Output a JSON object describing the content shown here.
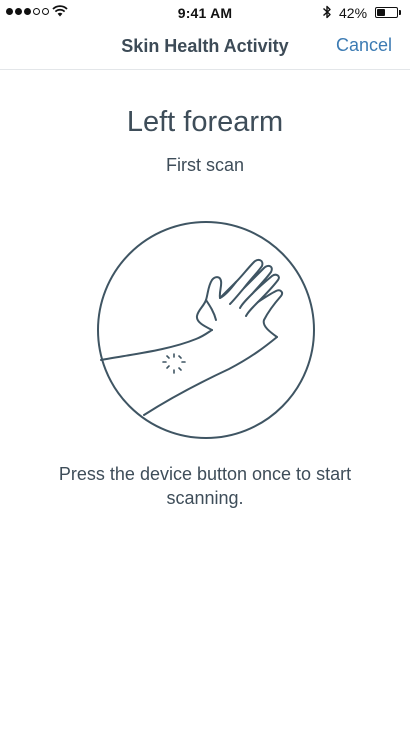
{
  "status_bar": {
    "signal_strength": 3,
    "signal_total": 5,
    "time": "9:41 AM",
    "battery_percent_text": "42%",
    "battery_level": 0.42,
    "icons": [
      "signal-dots-icon",
      "wifi-icon",
      "bluetooth-icon",
      "battery-icon"
    ]
  },
  "nav": {
    "title": "Skin Health Activity",
    "cancel_label": "Cancel"
  },
  "main": {
    "location_title": "Left forearm",
    "scan_subtitle": "First scan",
    "illustration_icon": "forearm-scan-illustration",
    "instruction": "Press the device button once to start scanning."
  },
  "colors": {
    "accent": "#3c7bb3",
    "text": "#3e4d59",
    "line_art": "#3f5563",
    "divider": "#e3e6e9"
  }
}
